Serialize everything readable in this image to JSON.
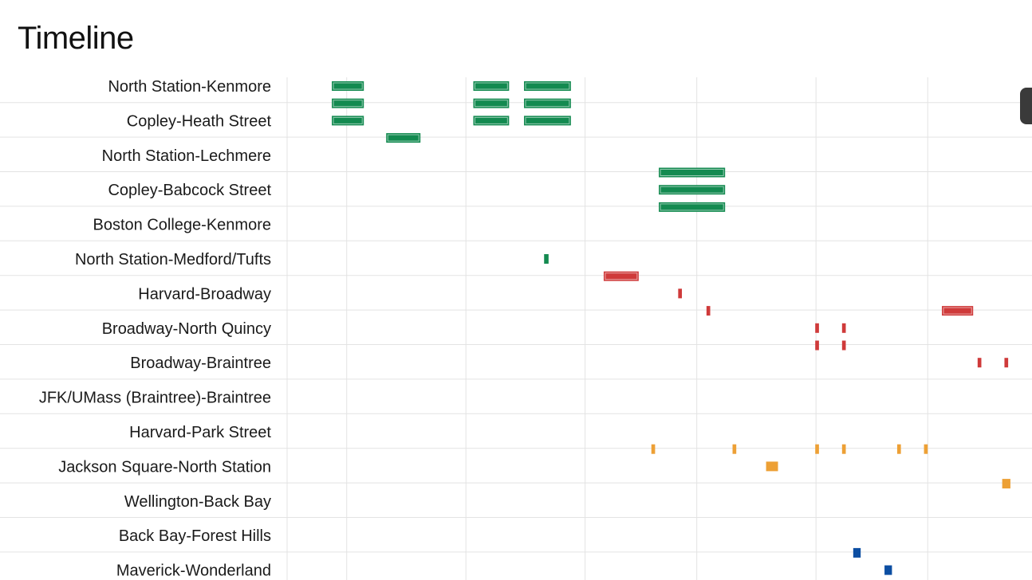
{
  "page": {
    "title": "Timeline"
  },
  "colors": {
    "green_line": "#138a50",
    "red_line": "#cf3a3a",
    "orange_line": "#eda035",
    "blue_line": "#0c4ea2",
    "grid": "#e3e3e3"
  },
  "chart_data": {
    "type": "timeline",
    "title": "Timeline",
    "x_unit": "time",
    "xlim": [
      0,
      100
    ],
    "grid": true,
    "rows": [
      "North Station-Kenmore",
      "Copley-Heath Street",
      "North Station-Lechmere",
      "Copley-Babcock Street",
      "Boston College-Kenmore",
      "North Station-Medford/Tufts",
      "Harvard-Broadway",
      "Broadway-North Quincy",
      "Broadway-Braintree",
      "JFK/UMass (Braintree)-Braintree",
      "Harvard-Park Street",
      "Jackson Square-North Station",
      "Wellington-Back Bay",
      "Back Bay-Forest Hills",
      "Maverick-Wonderland"
    ],
    "events": [
      {
        "row": 0.0,
        "start": 6.0,
        "end": 10.3,
        "color": "green_line",
        "outline": true
      },
      {
        "row": 0.5,
        "start": 6.0,
        "end": 10.3,
        "color": "green_line",
        "outline": true
      },
      {
        "row": 1.0,
        "start": 6.0,
        "end": 10.3,
        "color": "green_line",
        "outline": true
      },
      {
        "row": 0.0,
        "start": 25.0,
        "end": 29.8,
        "color": "green_line",
        "outline": true
      },
      {
        "row": 0.5,
        "start": 25.0,
        "end": 29.8,
        "color": "green_line",
        "outline": true
      },
      {
        "row": 1.0,
        "start": 25.0,
        "end": 29.8,
        "color": "green_line",
        "outline": true
      },
      {
        "row": 0.0,
        "start": 31.8,
        "end": 38.1,
        "color": "green_line",
        "outline": true
      },
      {
        "row": 0.5,
        "start": 31.8,
        "end": 38.1,
        "color": "green_line",
        "outline": true
      },
      {
        "row": 1.0,
        "start": 31.8,
        "end": 38.1,
        "color": "green_line",
        "outline": true
      },
      {
        "row": 1.5,
        "start": 13.3,
        "end": 17.9,
        "color": "green_line",
        "outline": true
      },
      {
        "row": 2.5,
        "start": 49.9,
        "end": 58.8,
        "color": "green_line",
        "outline": true
      },
      {
        "row": 3.0,
        "start": 49.9,
        "end": 58.8,
        "color": "green_line",
        "outline": true
      },
      {
        "row": 3.5,
        "start": 49.9,
        "end": 58.8,
        "color": "green_line",
        "outline": true
      },
      {
        "row": 5.0,
        "start": 34.5,
        "end": 35.1,
        "color": "green_line"
      },
      {
        "row": 5.5,
        "start": 42.5,
        "end": 47.2,
        "color": "red_line",
        "outline": true
      },
      {
        "row": 6.0,
        "start": 52.5,
        "end": 53.0,
        "color": "red_line"
      },
      {
        "row": 6.5,
        "start": 56.3,
        "end": 56.8,
        "color": "red_line"
      },
      {
        "row": 6.5,
        "start": 87.9,
        "end": 92.1,
        "color": "red_line",
        "outline": true
      },
      {
        "row": 7.0,
        "start": 70.9,
        "end": 71.4,
        "color": "red_line"
      },
      {
        "row": 7.0,
        "start": 74.5,
        "end": 75.0,
        "color": "red_line"
      },
      {
        "row": 7.5,
        "start": 70.9,
        "end": 71.4,
        "color": "red_line"
      },
      {
        "row": 7.5,
        "start": 74.5,
        "end": 75.0,
        "color": "red_line"
      },
      {
        "row": 8.0,
        "start": 92.7,
        "end": 93.2,
        "color": "red_line"
      },
      {
        "row": 8.0,
        "start": 96.3,
        "end": 96.8,
        "color": "red_line"
      },
      {
        "row": 10.5,
        "start": 48.9,
        "end": 49.4,
        "color": "orange_line"
      },
      {
        "row": 10.5,
        "start": 59.8,
        "end": 60.3,
        "color": "orange_line"
      },
      {
        "row": 10.5,
        "start": 70.9,
        "end": 71.4,
        "color": "orange_line"
      },
      {
        "row": 10.5,
        "start": 74.5,
        "end": 75.0,
        "color": "orange_line"
      },
      {
        "row": 10.5,
        "start": 81.9,
        "end": 82.4,
        "color": "orange_line"
      },
      {
        "row": 10.5,
        "start": 85.5,
        "end": 86.0,
        "color": "orange_line"
      },
      {
        "row": 11.0,
        "start": 64.3,
        "end": 65.9,
        "color": "orange_line"
      },
      {
        "row": 11.5,
        "start": 96.0,
        "end": 97.1,
        "color": "orange_line"
      },
      {
        "row": 13.5,
        "start": 76.0,
        "end": 77.0,
        "color": "blue_line"
      },
      {
        "row": 14.0,
        "start": 80.2,
        "end": 81.2,
        "color": "blue_line"
      }
    ]
  }
}
